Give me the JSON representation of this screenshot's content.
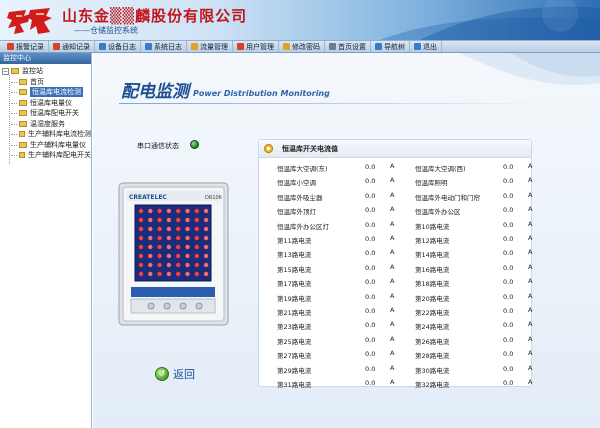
{
  "header": {
    "company": "山东金▒▒麟股份有限公司",
    "subsystem": "——仓储监控系统"
  },
  "toolbar": [
    {
      "label": "报警记录",
      "icon": "alarm-icon",
      "color": "#d9412b"
    },
    {
      "label": "通知记录",
      "icon": "notice-icon",
      "color": "#d9412b"
    },
    {
      "label": "设备日志",
      "icon": "device-log-icon",
      "color": "#3a7bc8"
    },
    {
      "label": "系统日志",
      "icon": "system-log-icon",
      "color": "#3a7bc8"
    },
    {
      "label": "流量管理",
      "icon": "flow-icon",
      "color": "#e2a12a"
    },
    {
      "label": "用户管理",
      "icon": "user-icon",
      "color": "#d9412b"
    },
    {
      "label": "修改密码",
      "icon": "key-icon",
      "color": "#e2a12a"
    },
    {
      "label": "首页设置",
      "icon": "wrench-icon",
      "color": "#6a7d94"
    },
    {
      "label": "导航树",
      "icon": "nav-tree-icon",
      "color": "#3a7bc8"
    },
    {
      "label": "退出",
      "icon": "exit-icon",
      "color": "#3a7bc8"
    }
  ],
  "sidebar": {
    "title": "监控中心",
    "root": "监控站",
    "items": [
      {
        "label": "首页",
        "selected": false
      },
      {
        "label": "恒温库电流检测",
        "selected": true
      },
      {
        "label": "恒温库电量仪",
        "selected": false
      },
      {
        "label": "恒温库配电开关",
        "selected": false
      },
      {
        "label": "温湿度服务",
        "selected": false
      },
      {
        "label": "生产辅料库电流检测",
        "selected": false
      },
      {
        "label": "生产辅料库电量仪",
        "selected": false
      },
      {
        "label": "生产辅料库配电开关",
        "selected": false
      }
    ]
  },
  "main": {
    "title": "配电监测",
    "subtitle": "Power Distribution Monitoring",
    "comm_label": "串口通信状态",
    "comm_status_color": "#1b9a1b",
    "back_label": "返回",
    "device_brand": "CREATELEC",
    "device_model": "DR106",
    "panel_title": "恒温库开关电流值",
    "unit": "A",
    "rows": [
      [
        {
          "name": "恒温库大空调(东)",
          "value": "0.0"
        },
        {
          "name": "恒温库大空调(西)",
          "value": "0.0"
        }
      ],
      [
        {
          "name": "恒温库小空调",
          "value": "0.0"
        },
        {
          "name": "恒温库照明",
          "value": "0.0"
        }
      ],
      [
        {
          "name": "恒温库外吸尘器",
          "value": "0.0"
        },
        {
          "name": "恒温库外电动门和门帘",
          "value": "0.0"
        }
      ],
      [
        {
          "name": "恒温库外顶灯",
          "value": "0.0"
        },
        {
          "name": "恒温库外办公区",
          "value": "0.0"
        }
      ],
      [
        {
          "name": "恒温库外办公区灯",
          "value": "0.0"
        },
        {
          "name": "第10路电流",
          "value": "0.0"
        }
      ],
      [
        {
          "name": "第11路电流",
          "value": "0.0"
        },
        {
          "name": "第12路电流",
          "value": "0.0"
        }
      ],
      [
        {
          "name": "第13路电流",
          "value": "0.0"
        },
        {
          "name": "第14路电流",
          "value": "0.0"
        }
      ],
      [
        {
          "name": "第15路电流",
          "value": "0.0"
        },
        {
          "name": "第16路电流",
          "value": "0.0"
        }
      ],
      [
        {
          "name": "第17路电流",
          "value": "0.0"
        },
        {
          "name": "第18路电流",
          "value": "0.0"
        }
      ],
      [
        {
          "name": "第19路电流",
          "value": "0.0"
        },
        {
          "name": "第20路电流",
          "value": "0.0"
        }
      ],
      [
        {
          "name": "第21路电流",
          "value": "0.0"
        },
        {
          "name": "第22路电流",
          "value": "0.0"
        }
      ],
      [
        {
          "name": "第23路电流",
          "value": "0.0"
        },
        {
          "name": "第24路电流",
          "value": "0.0"
        }
      ],
      [
        {
          "name": "第25路电流",
          "value": "0.0"
        },
        {
          "name": "第26路电流",
          "value": "0.0"
        }
      ],
      [
        {
          "name": "第27路电流",
          "value": "0.0"
        },
        {
          "name": "第28路电流",
          "value": "0.0"
        }
      ],
      [
        {
          "name": "第29路电流",
          "value": "0.0"
        },
        {
          "name": "第30路电流",
          "value": "0.0"
        }
      ],
      [
        {
          "name": "第31路电流",
          "value": "0.0"
        },
        {
          "name": "第32路电流",
          "value": "0.0"
        }
      ]
    ]
  }
}
